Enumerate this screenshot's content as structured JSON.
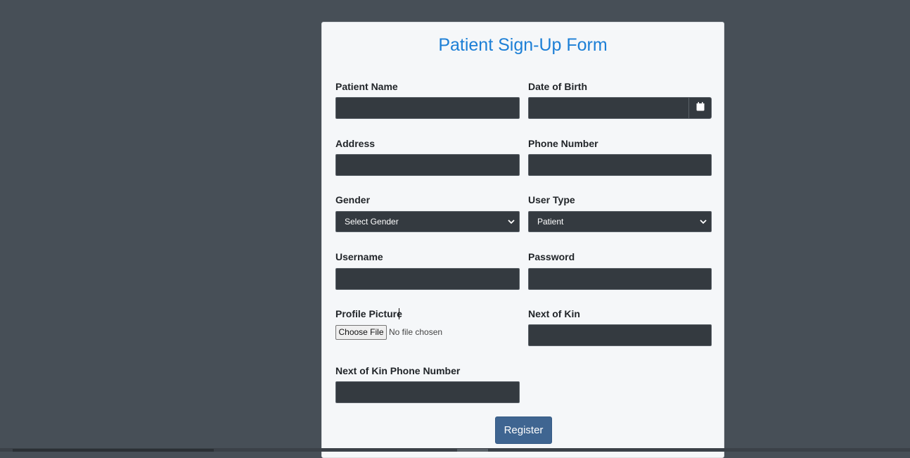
{
  "form": {
    "title": "Patient Sign-Up Form",
    "fields": {
      "patient_name": {
        "label": "Patient Name",
        "value": ""
      },
      "date_of_birth": {
        "label": "Date of Birth",
        "value": ""
      },
      "address": {
        "label": "Address",
        "value": ""
      },
      "phone_number": {
        "label": "Phone Number",
        "value": ""
      },
      "gender": {
        "label": "Gender",
        "selected": "Select Gender"
      },
      "user_type": {
        "label": "User Type",
        "selected": "Patient"
      },
      "username": {
        "label": "Username",
        "value": ""
      },
      "password": {
        "label": "Password",
        "value": ""
      },
      "profile_picture": {
        "label": "Profile Picture",
        "button": "Choose File",
        "status": "No file chosen"
      },
      "next_of_kin": {
        "label": "Next of Kin",
        "value": ""
      },
      "next_of_kin_phone": {
        "label": "Next of Kin Phone Number",
        "value": ""
      }
    },
    "submit_label": "Register"
  },
  "colors": {
    "page_background": "#474f57",
    "card_background": "#f5f7f9",
    "title": "#1c7fd6",
    "input_background": "#343a40",
    "button": "#3f6591"
  },
  "icons": {
    "calendar": "calendar-icon",
    "dropdown": "chevron-down-icon"
  }
}
